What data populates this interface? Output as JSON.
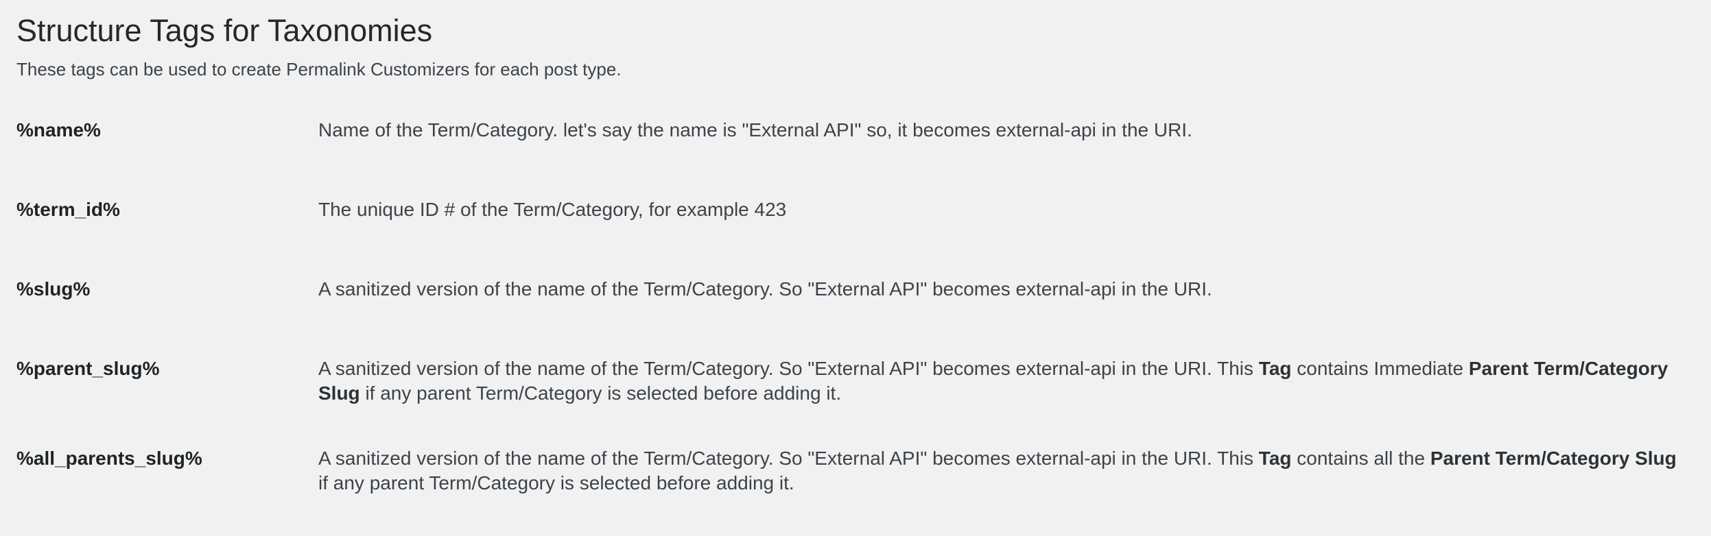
{
  "page": {
    "title": "Structure Tags for Taxonomies",
    "subtitle": "These tags can be used to create Permalink Customizers for each post type."
  },
  "tags": [
    {
      "tag": "%name%",
      "description": "Name of the Term/Category. let's say the name is \"External API\" so, it becomes external-api in the URI."
    },
    {
      "tag": "%term_id%",
      "description": "The unique ID # of the Term/Category, for example 423"
    },
    {
      "tag": "%slug%",
      "description": "A sanitized version of the name of the Term/Category. So \"External API\" becomes external-api in the URI."
    },
    {
      "tag": "%parent_slug%",
      "description_parts": {
        "p1": "A sanitized version of the name of the Term/Category. So \"External API\" becomes external-api in the URI. This ",
        "b1": "Tag",
        "p2": " contains Immediate ",
        "b2": "Parent Term/Category Slug",
        "p3": " if any parent Term/Category is selected before adding it."
      }
    },
    {
      "tag": "%all_parents_slug%",
      "description_parts": {
        "p1": "A sanitized version of the name of the Term/Category. So \"External API\" becomes external-api in the URI. This ",
        "b1": "Tag",
        "p2": " contains all the ",
        "b2": "Parent Term/Category Slug",
        "p3": " if any parent Term/Category is selected before adding it."
      }
    }
  ]
}
